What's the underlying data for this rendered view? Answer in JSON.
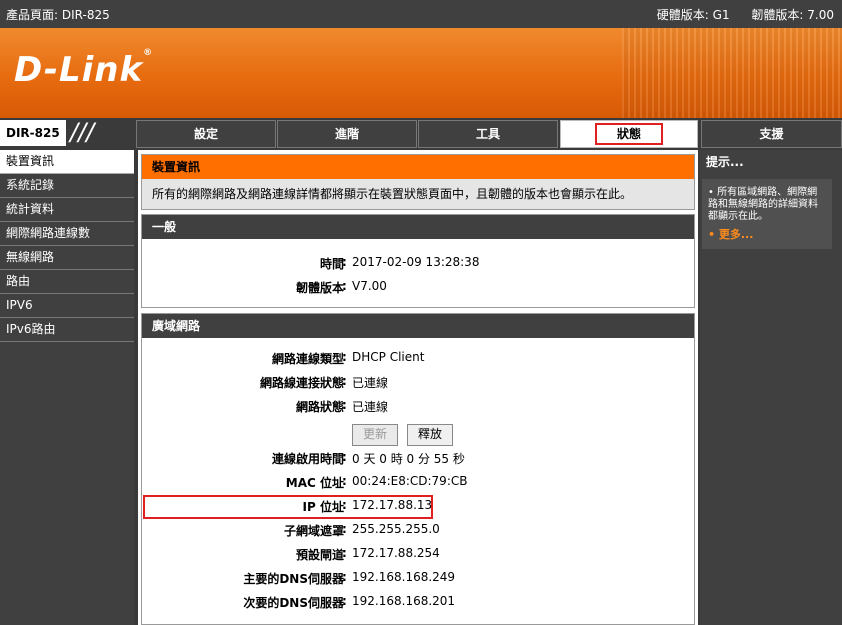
{
  "topbar": {
    "product": "產品頁面: DIR-825",
    "hw_version": "硬體版本: G1",
    "fw_version": "韌體版本: 7.00"
  },
  "brand": {
    "logo": "D-Link",
    "model": "DIR-825",
    "slashes": "///"
  },
  "tabs": [
    "設定",
    "進階",
    "工具",
    "狀態",
    "支援"
  ],
  "sidebar": {
    "items": [
      "裝置資訊",
      "系統記錄",
      "統計資料",
      "網際網路連線數",
      "無線網路",
      "路由",
      "IPV6",
      "IPv6路由"
    ]
  },
  "device_info": {
    "title": "裝置資訊",
    "description": "所有的網際網路及網路連線詳情都將顯示在裝置狀態頁面中，且韌體的版本也會顯示在此。"
  },
  "general": {
    "title": "一般",
    "time_label": "時間",
    "time_value": "2017-02-09 13:28:38",
    "fw_label": "韌體版本",
    "fw_value": "V7.00"
  },
  "wan": {
    "title": "廣域網路",
    "rows": [
      {
        "label": "網路連線類型",
        "value": "DHCP Client"
      },
      {
        "label": "網路線連接狀態",
        "value": "已連線"
      },
      {
        "label": "網路狀態",
        "value": "已連線"
      },
      {
        "label": "連線啟用時間",
        "value": "0 天 0 時 0 分 55 秒"
      },
      {
        "label": "MAC 位址",
        "value": "00:24:E8:CD:79:CB"
      },
      {
        "label": "IP 位址",
        "value": "172.17.88.13"
      },
      {
        "label": "子網域遮罩",
        "value": "255.255.255.0"
      },
      {
        "label": "預設閘道",
        "value": "172.17.88.254"
      },
      {
        "label": "主要的DNS伺服器",
        "value": "192.168.168.249"
      },
      {
        "label": "次要的DNS伺服器",
        "value": "192.168.168.201"
      }
    ],
    "renew": "更新",
    "release": "釋放"
  },
  "hints": {
    "title": "提示...",
    "text": "所有區域網路、網際網路和無線網路的詳細資料都顯示在此。",
    "more": "更多..."
  },
  "colors": {
    "accent": "#ff6f00",
    "highlight": "#e02020",
    "dark": "#404040"
  }
}
